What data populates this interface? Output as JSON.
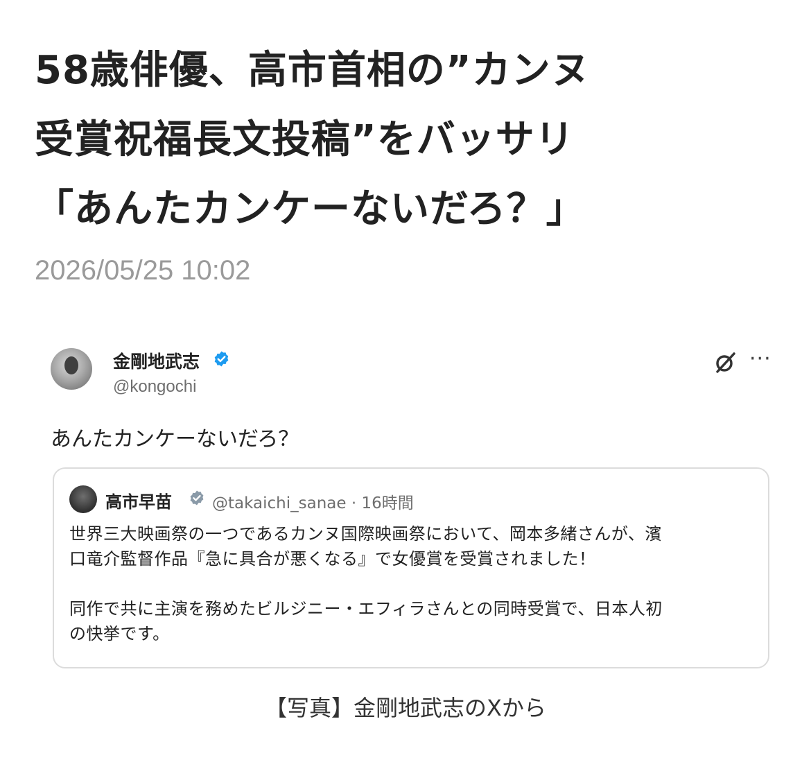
{
  "article": {
    "headline_lines": [
      "58歳俳優、高市首相の”カンヌ",
      "受賞祝福長文投稿”をバッサリ",
      "「あんたカンケーないだろ？」"
    ],
    "timestamp": "2026/05/25 10:02",
    "caption": "【写真】金剛地武志のXから"
  },
  "post": {
    "author_name": "金剛地武志",
    "handle": "@kongochi",
    "text": "あんたカンケーないだろ？",
    "icons": {
      "verified": "verified-badge-icon",
      "grok": "grok-icon",
      "more": "more-options-icon"
    },
    "quoted": {
      "author_name": "高市早苗",
      "meta": "@takaichi_sanae · 16時間",
      "body_lines": [
        "世界三大映画祭の一つであるカンヌ国際映画祭において、岡本多緒さんが、濱",
        "口竜介監督作品『急に具合が悪くなる』で女優賞を受賞されました！",
        "",
        "同作で共に主演を務めたビルジニー・エフィラさんとの同時受賞で、日本人初",
        "の快挙です。"
      ]
    }
  },
  "colors": {
    "verified_blue": "#1d9bf0",
    "timestamp_gray": "#9a9a9a",
    "card_border": "#dcdcdc"
  }
}
